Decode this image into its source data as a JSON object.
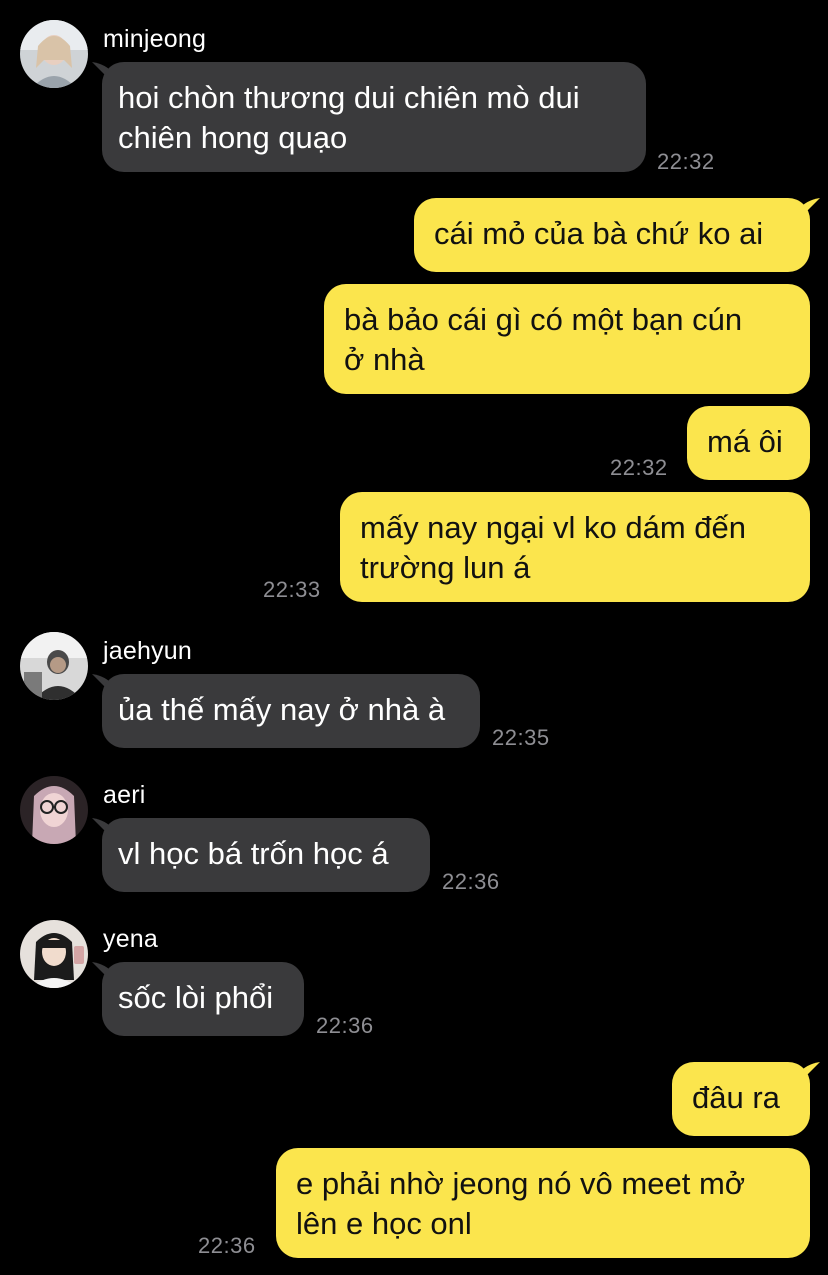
{
  "theme": {
    "background": "#000000",
    "incoming_bubble": "#3a3a3c",
    "outgoing_bubble": "#fbe54d",
    "timestamp_color": "#8e8e93"
  },
  "messages": [
    {
      "sender": "minjeong",
      "avatar_icon": "user-avatar-icon",
      "line1": "hoi chòn thương dui chiên mò dui",
      "line2": "chiên hong quạo",
      "time": "22:32"
    },
    {
      "line1": "cái mỏ của bà chứ ko ai"
    },
    {
      "line1": "bà bảo cái gì có một bạn cún",
      "line2": "ở nhà"
    },
    {
      "line1": "má ôi",
      "time": "22:32"
    },
    {
      "line1": "mấy nay ngại vl ko dám đến",
      "line2": "trường lun á",
      "time": "22:33"
    },
    {
      "sender": "jaehyun",
      "avatar_icon": "user-avatar-icon",
      "line1": "ủa thế mấy nay ở nhà à",
      "time": "22:35"
    },
    {
      "sender": "aeri",
      "avatar_icon": "user-avatar-icon",
      "line1": "vl học bá trốn học á",
      "time": "22:36"
    },
    {
      "sender": "yena",
      "avatar_icon": "user-avatar-icon",
      "line1": "sốc lòi phổi",
      "time": "22:36"
    },
    {
      "line1": "đâu ra"
    },
    {
      "line1": "e phải nhờ jeong nó vô meet mở",
      "line2": "lên e học onl",
      "time": "22:36"
    }
  ]
}
